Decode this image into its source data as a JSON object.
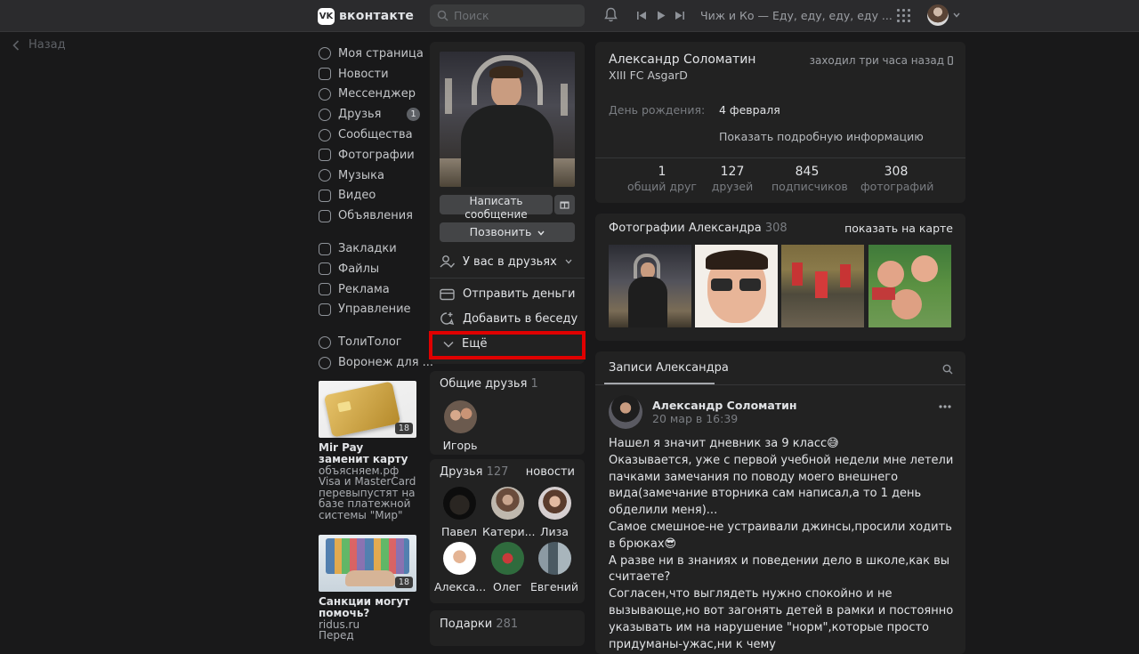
{
  "header": {
    "logo_text": "вконтакте",
    "logo_mark": "VK",
    "search_placeholder": "Поиск",
    "now_playing": "Чиж и Ко — Еду, еду, еду, еду ..."
  },
  "back": {
    "label": "Назад"
  },
  "menu": {
    "items": [
      {
        "label": "Моя страница",
        "icon": "user-circle-icon"
      },
      {
        "label": "Новости",
        "icon": "news-icon"
      },
      {
        "label": "Мессенджер",
        "icon": "message-icon"
      },
      {
        "label": "Друзья",
        "icon": "friends-icon",
        "badge": "1"
      },
      {
        "label": "Сообщества",
        "icon": "communities-icon"
      },
      {
        "label": "Фотографии",
        "icon": "photos-icon"
      },
      {
        "label": "Музыка",
        "icon": "music-icon"
      },
      {
        "label": "Видео",
        "icon": "video-icon"
      },
      {
        "label": "Объявления",
        "icon": "ads-icon"
      }
    ],
    "items2": [
      {
        "label": "Закладки",
        "icon": "star-icon"
      },
      {
        "label": "Файлы",
        "icon": "file-icon"
      },
      {
        "label": "Реклама",
        "icon": "megaphone-icon"
      },
      {
        "label": "Управление",
        "icon": "apps-icon"
      }
    ],
    "items3": [
      {
        "label": "ТолиТолог",
        "icon": "group-icon"
      },
      {
        "label": "Воронеж для ...",
        "icon": "group-icon"
      }
    ]
  },
  "ads": [
    {
      "age": "18",
      "title": "Mir Pay заменит карту",
      "domain": "объясняем.рф",
      "text": "Visa и MasterCard перевыпустят на базе платежной системы \"Мир\""
    },
    {
      "age": "18",
      "title": "Санкции могут помочь?",
      "domain": "ridus.ru",
      "text": "Перед"
    }
  ],
  "profile": {
    "write_message": "Написать сообщение",
    "call": "Позвонить",
    "friends_status": "У вас в друзьях",
    "send_money": "Отправить деньги",
    "add_to_chat": "Добавить в беседу",
    "more": "Ещё"
  },
  "mutual_friends": {
    "title": "Общие друзья",
    "count": "1",
    "items": [
      {
        "name": "Игорь"
      }
    ]
  },
  "friends": {
    "title": "Друзья",
    "count": "127",
    "news_link": "новости",
    "items": [
      {
        "name": "Павел"
      },
      {
        "name": "Катери..."
      },
      {
        "name": "Лиза"
      },
      {
        "name": "Алекса..."
      },
      {
        "name": "Олег"
      },
      {
        "name": "Евгений"
      }
    ]
  },
  "gifts": {
    "title": "Подарки",
    "count": "281"
  },
  "info": {
    "name": "Александр Соломатин",
    "status": "XIII FC AsgarD",
    "last_seen": "заходил три часа назад",
    "birthday_label": "День рождения:",
    "birthday_value": "4 февраля",
    "show_more": "Показать подробную информацию",
    "stats": [
      {
        "num": "1",
        "label": "общий друг"
      },
      {
        "num": "127",
        "label": "друзей"
      },
      {
        "num": "845",
        "label": "подписчиков"
      },
      {
        "num": "308",
        "label": "фотографий"
      }
    ]
  },
  "photos": {
    "title": "Фотографии Александра",
    "count": "308",
    "map_link": "показать на карте"
  },
  "posts": {
    "tab_label": "Записи Александра",
    "post": {
      "author": "Александр Соломатин",
      "date": "20 мар в 16:39",
      "lines": [
        "Нашел я значит дневник за 9 класс😅",
        "Оказывается, уже с первой учебной недели мне летели пачками замечания по поводу моего внешнего вида(замечание вторника сам написал,а то 1 день обделили меня)...",
        "Самое смешное-не устраивали джинсы,просили ходить в брюках😎",
        "А разве ни в знаниях и поведении дело в школе,как вы считаете?",
        "Согласен,что выглядеть нужно спокойно и не вызывающе,но вот загонять детей в рамки и постоянно указывать им на нарушение \"норм\",которые просто придуманы-ужас,ни к чему"
      ]
    }
  }
}
